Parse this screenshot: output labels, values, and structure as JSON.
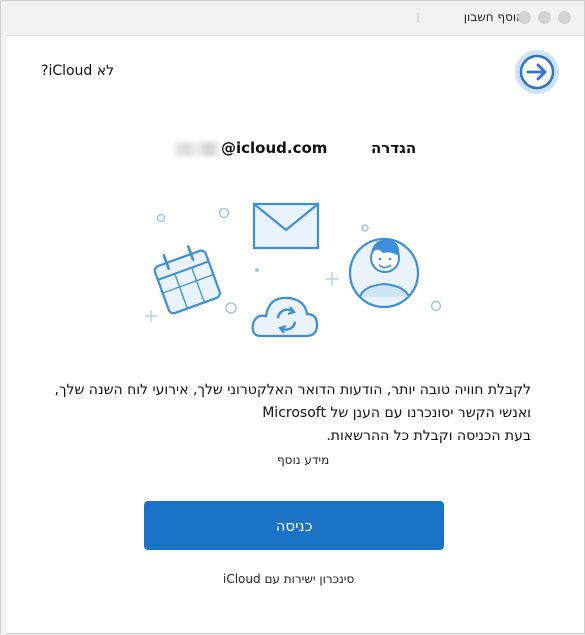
{
  "window": {
    "title": "הוסף חשבון"
  },
  "header": {
    "no_icloud_link": "לא iCloud?"
  },
  "account": {
    "setup_label": "הגדרה",
    "email_suffix": "@icloud.com"
  },
  "description": {
    "line1": "לקבלת חוויה טובה יותר, הודעות הדואר האלקטרוני שלך, אירועי לוח השנה שלך,",
    "line2": "ואנשי הקשר יסונכרנו עם הענן של Microsoft",
    "line3": "בעת הכניסה וקבלת כל ההרשאות."
  },
  "more_info": "מידע נוסף",
  "signin_button": "כניסה",
  "sync_note": "סינכרון ישירות עם iCloud",
  "icons": [
    "arrow-right-icon",
    "calendar-icon",
    "mail-envelope-icon",
    "cloud-sync-icon",
    "person-avatar-icon"
  ],
  "colors": {
    "accent": "#1a73c6",
    "illustration_blue": "#3d8ed8",
    "light_blue": "#cfe3f6"
  }
}
